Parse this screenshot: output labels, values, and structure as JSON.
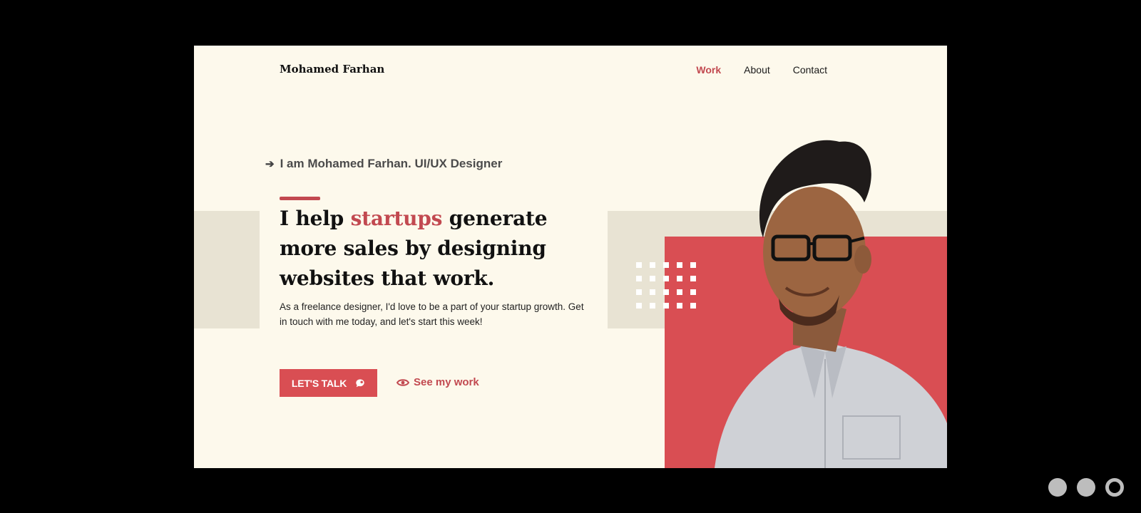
{
  "brand": "Mohamed Farhan",
  "nav": {
    "work": "Work",
    "about": "About",
    "contact": "Contact"
  },
  "hero": {
    "eyebrow": "I am Mohamed Farhan. UI/UX Designer",
    "headline_pre": "I help ",
    "headline_highlight": "startups",
    "headline_post": " generate more sales by designing websites that work.",
    "lede": "As a freelance designer, I'd love to be a part of your startup growth. Get in touch with me today, and let's start this week!",
    "cta_primary": "LET'S TALK",
    "cta_secondary": "See my work"
  },
  "icons": {
    "arrow": "arrow-right-icon",
    "bubble": "chat-bubble-icon",
    "eye": "eye-icon"
  },
  "colors": {
    "accent": "#c24950",
    "button": "#d94e53",
    "background": "#fdf9ec",
    "band": "#e8e3d3"
  },
  "pager": {
    "count": 3,
    "active_index": 2
  }
}
